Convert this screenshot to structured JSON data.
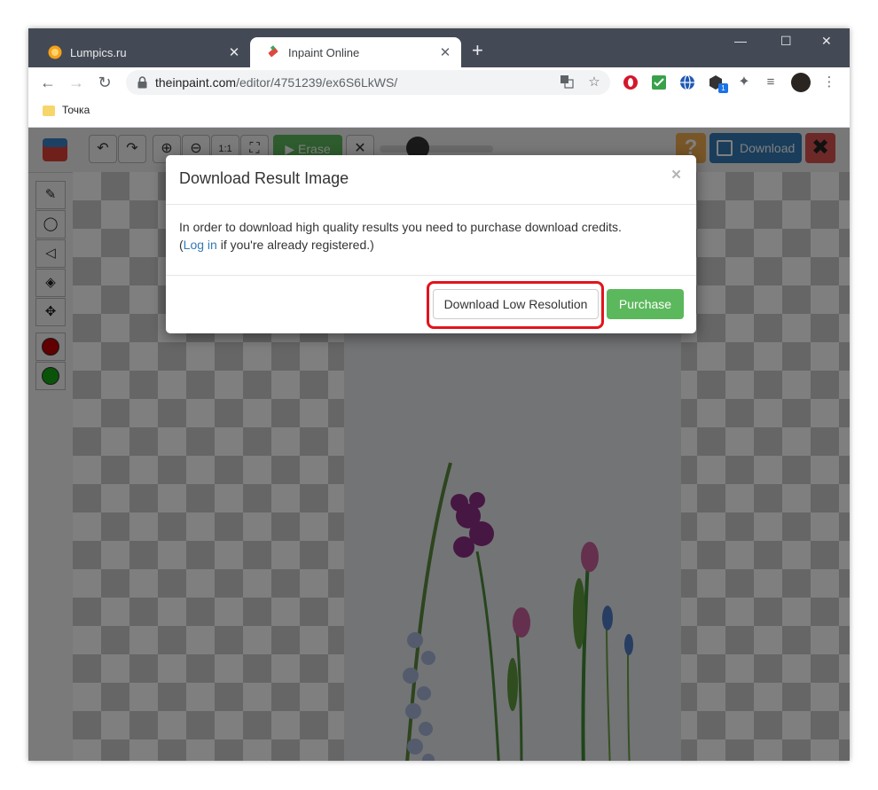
{
  "browser": {
    "tabs": [
      {
        "title": "Lumpics.ru",
        "active": false
      },
      {
        "title": "Inpaint Online",
        "active": true
      }
    ],
    "address": {
      "host": "theinpaint.com",
      "path": "/editor/4751239/ex6S6LkWS/"
    },
    "extension_badge": "1",
    "bookmark": "Точка"
  },
  "app": {
    "erase_label": "Erase",
    "help_label": "?",
    "download_label": "Download",
    "close_label": "✖",
    "colors": {
      "red_brush": "#c00000",
      "green_brush": "#13a813",
      "erase_green": "#5cb85c",
      "download_blue": "#337ab7",
      "close_red": "#d9534f",
      "help_orange": "#f0ad4e"
    }
  },
  "modal": {
    "title": "Download Result Image",
    "close": "×",
    "body_line1": "In order to download high quality results you need to purchase download credits.",
    "body_open_paren": "(",
    "login_link": "Log in",
    "body_line2_rest": " if you're already registered.)",
    "low_res_button": "Download Low Resolution",
    "purchase_button": "Purchase",
    "highlight_color": "#e2141c"
  },
  "window_controls": {
    "minimize": "—",
    "maximize": "☐",
    "close": "✕"
  }
}
